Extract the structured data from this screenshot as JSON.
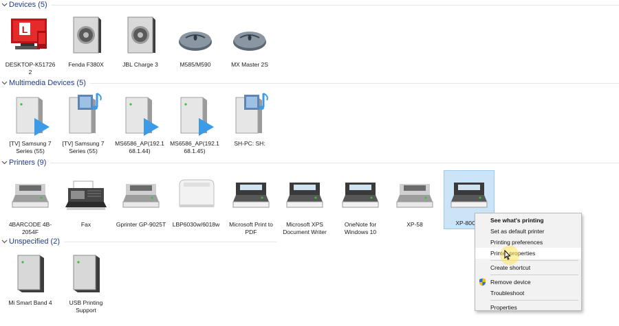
{
  "sections": {
    "devices": {
      "title": "Devices (5)"
    },
    "multimedia": {
      "title": "Multimedia Devices (5)"
    },
    "printers": {
      "title": "Printers (9)"
    },
    "unspecified": {
      "title": "Unspecified (2)"
    }
  },
  "devices": [
    {
      "label": "DESKTOP-K51726\n2",
      "icon": "computer-icon"
    },
    {
      "label": "Fenda F380X",
      "icon": "speaker-icon"
    },
    {
      "label": "JBL Charge 3",
      "icon": "speaker-icon"
    },
    {
      "label": "M585/M590",
      "icon": "mouse-icon"
    },
    {
      "label": "MX Master 2S",
      "icon": "mouse-icon"
    }
  ],
  "multimedia": [
    {
      "label": "[TV] Samsung 7 Series (55)",
      "icon": "media-server-icon"
    },
    {
      "label": "[TV] Samsung 7 Series (55)",
      "icon": "media-renderer-icon"
    },
    {
      "label": "MS6586_AP(192.168.1.44)",
      "icon": "media-server-icon"
    },
    {
      "label": "MS6586_AP(192.168.1.45)",
      "icon": "media-server-icon"
    },
    {
      "label": "SH-PC: SH:",
      "icon": "media-renderer-icon"
    }
  ],
  "printers": [
    {
      "label": "4BARCODE 4B-2054F",
      "icon": "printer-icon"
    },
    {
      "label": "Fax",
      "icon": "fax-icon"
    },
    {
      "label": "Gprinter GP-9025T",
      "icon": "printer-icon"
    },
    {
      "label": "LBP6030w/6018w",
      "icon": "laser-printer-icon"
    },
    {
      "label": "Microsoft Print to PDF",
      "icon": "printer-icon"
    },
    {
      "label": "Microsoft XPS Document Writer",
      "icon": "printer-icon"
    },
    {
      "label": "OneNote for Windows 10",
      "icon": "printer-icon"
    },
    {
      "label": "XP-58",
      "icon": "printer-icon"
    },
    {
      "label": "XP-80C (c",
      "icon": "printer-icon"
    }
  ],
  "unspecified": [
    {
      "label": "Mi Smart Band 4",
      "icon": "device-tower-icon"
    },
    {
      "label": "USB Printing Support",
      "icon": "device-tower-icon"
    }
  ],
  "context_menu": {
    "see_whats_printing": "See what's printing",
    "set_default": "Set as default printer",
    "printing_preferences": "Printing preferences",
    "printer_properties": "Printer properties",
    "create_shortcut": "Create shortcut",
    "remove_device": "Remove device",
    "troubleshoot": "Troubleshoot",
    "properties": "Properties"
  },
  "colors": {
    "section_title": "#1e3a8a",
    "selection": "#cce4f7",
    "cursor_highlight": "#ffe65a"
  }
}
